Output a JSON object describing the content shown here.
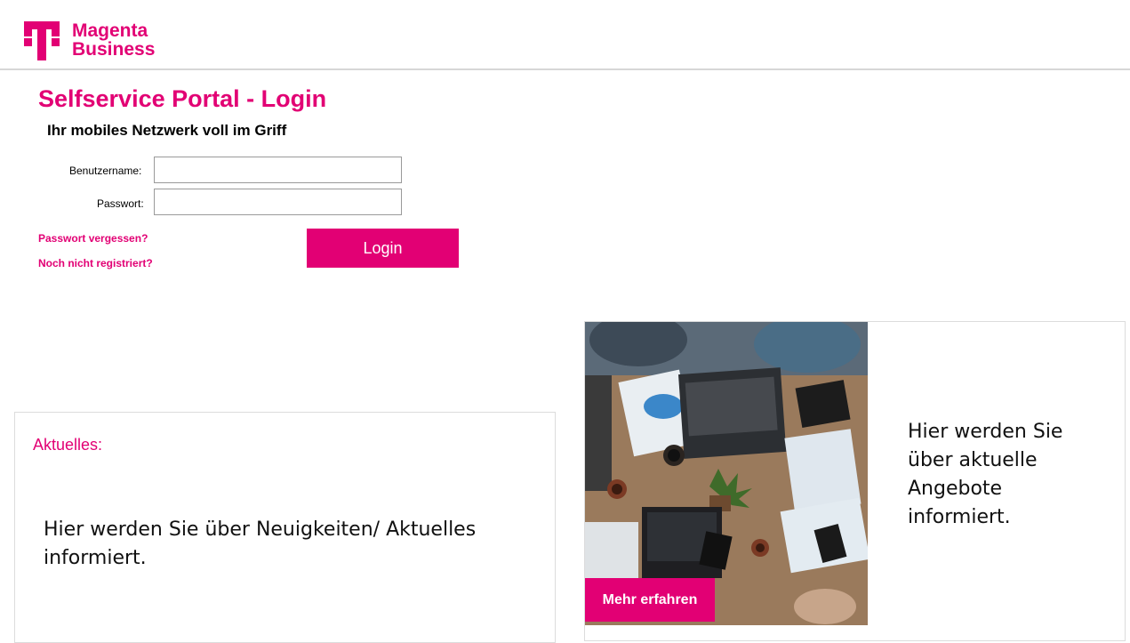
{
  "header": {
    "logo_icon": "telekom-t-logo",
    "brand_line1": "Magenta",
    "brand_line2": "Business"
  },
  "login": {
    "title": "Selfservice Portal - Login",
    "subtitle": "Ihr mobiles Netzwerk voll im Griff",
    "username_label": "Benutzername:",
    "username_value": "",
    "password_label": "Passwort:",
    "password_value": "",
    "forgot_link": "Passwort vergessen?",
    "register_link": "Noch nicht registriert?",
    "login_button": "Login"
  },
  "news": {
    "title": "Aktuelles:",
    "text": "Hier werden Sie über Neuigkeiten/ Aktuelles informiert."
  },
  "promo": {
    "image": "office-team-with-laptops-photo",
    "text": "Hier werden Sie über aktuelle Angebote informiert.",
    "button": "Mehr erfahren"
  },
  "colors": {
    "accent": "#e20074"
  }
}
